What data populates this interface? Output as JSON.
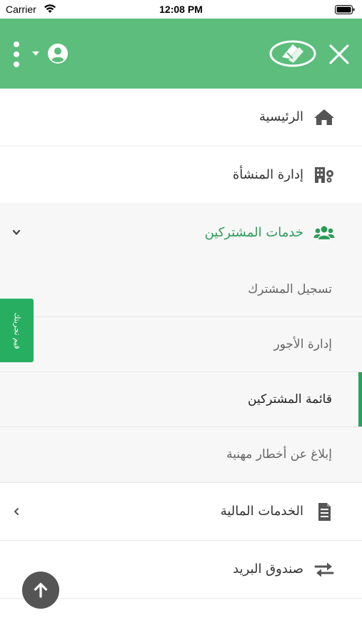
{
  "status_bar": {
    "carrier": "Carrier",
    "time": "12:08 PM"
  },
  "header": {
    "close_icon": "close-icon",
    "logo_icon": "app-logo",
    "profile_icon": "user-circle-icon",
    "more_icon": "more-vertical-icon",
    "colors": {
      "background": "#5cbd7c"
    }
  },
  "menu": {
    "home": {
      "label": "الرئيسية",
      "icon": "home-icon"
    },
    "facility": {
      "label": "إدارة المنشأة",
      "icon": "building-gear-icon"
    },
    "subscriber_services": {
      "label": "خدمات المشتركين",
      "icon": "users-icon",
      "expanded": true,
      "items": [
        {
          "label": "تسجيل المشترك"
        },
        {
          "label": "إدارة الأجور"
        },
        {
          "label": "قائمة المشتركين"
        },
        {
          "label": "إبلاغ عن أخطار مهنية"
        }
      ],
      "active_index": 2
    },
    "financial": {
      "label": "الخدمات المالية",
      "icon": "document-icon"
    },
    "mailbox": {
      "label": "صندوق البريد",
      "icon": "exchange-arrows-icon"
    }
  },
  "feedback_tab": {
    "label": "قيم تجربتك"
  },
  "accent_color": "#2aa15b"
}
